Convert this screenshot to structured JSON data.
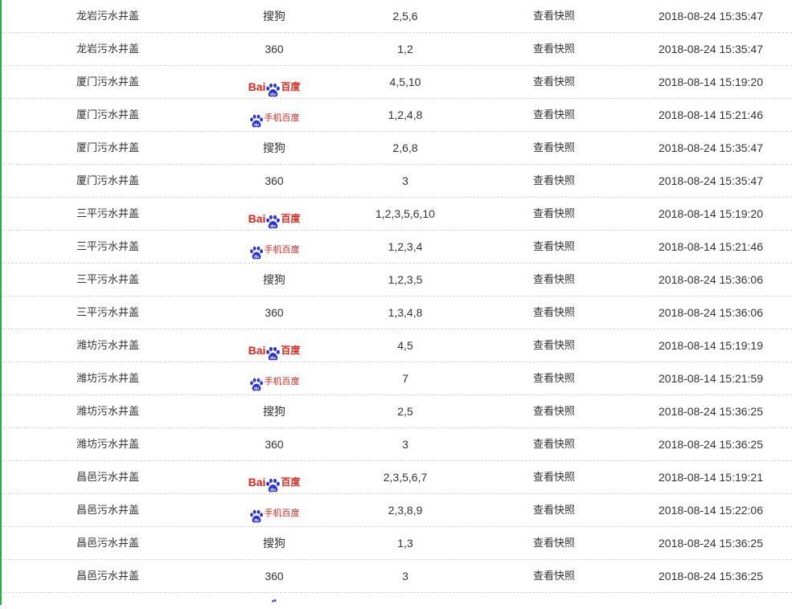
{
  "snapshot_label": "查看快照",
  "engines": {
    "baidu": {
      "latin": "Bai",
      "cn": "百度"
    },
    "mobile_baidu": {
      "cn": "手机百度"
    },
    "sogou": "搜狗",
    "so360": "360"
  },
  "colors": {
    "accent_border": "#1fb04a",
    "baidu_red": "#e1251b",
    "baidu_blue": "#2932e1",
    "divider": "#d4d4d4"
  },
  "rows": [
    {
      "keyword": "龙岩污水井盖",
      "engine": "sogou",
      "ranks": "2,5,6",
      "time": "2018-08-24 15:35:47"
    },
    {
      "keyword": "龙岩污水井盖",
      "engine": "so360",
      "ranks": "1,2",
      "time": "2018-08-24 15:35:47"
    },
    {
      "keyword": "厦门污水井盖",
      "engine": "baidu",
      "ranks": "4,5,10",
      "time": "2018-08-14 15:19:20"
    },
    {
      "keyword": "厦门污水井盖",
      "engine": "mobile_baidu",
      "ranks": "1,2,4,8",
      "time": "2018-08-14 15:21:46"
    },
    {
      "keyword": "厦门污水井盖",
      "engine": "sogou",
      "ranks": "2,6,8",
      "time": "2018-08-24 15:35:47"
    },
    {
      "keyword": "厦门污水井盖",
      "engine": "so360",
      "ranks": "3",
      "time": "2018-08-24 15:35:47"
    },
    {
      "keyword": "三平污水井盖",
      "engine": "baidu",
      "ranks": "1,2,3,5,6,10",
      "time": "2018-08-14 15:19:20"
    },
    {
      "keyword": "三平污水井盖",
      "engine": "mobile_baidu",
      "ranks": "1,2,3,4",
      "time": "2018-08-14 15:21:46"
    },
    {
      "keyword": "三平污水井盖",
      "engine": "sogou",
      "ranks": "1,2,3,5",
      "time": "2018-08-24 15:36:06"
    },
    {
      "keyword": "三平污水井盖",
      "engine": "so360",
      "ranks": "1,3,4,8",
      "time": "2018-08-24 15:36:06"
    },
    {
      "keyword": "潍坊污水井盖",
      "engine": "baidu",
      "ranks": "4,5",
      "time": "2018-08-14 15:19:19"
    },
    {
      "keyword": "潍坊污水井盖",
      "engine": "mobile_baidu",
      "ranks": "7",
      "time": "2018-08-14 15:21:59"
    },
    {
      "keyword": "潍坊污水井盖",
      "engine": "sogou",
      "ranks": "2,5",
      "time": "2018-08-24 15:36:25"
    },
    {
      "keyword": "潍坊污水井盖",
      "engine": "so360",
      "ranks": "3",
      "time": "2018-08-24 15:36:25"
    },
    {
      "keyword": "昌邑污水井盖",
      "engine": "baidu",
      "ranks": "2,3,5,6,7",
      "time": "2018-08-14 15:19:21"
    },
    {
      "keyword": "昌邑污水井盖",
      "engine": "mobile_baidu",
      "ranks": "2,3,8,9",
      "time": "2018-08-14 15:22:06"
    },
    {
      "keyword": "昌邑污水井盖",
      "engine": "sogou",
      "ranks": "1,3",
      "time": "2018-08-24 15:36:25"
    },
    {
      "keyword": "昌邑污水井盖",
      "engine": "so360",
      "ranks": "3",
      "time": "2018-08-24 15:36:25"
    }
  ]
}
